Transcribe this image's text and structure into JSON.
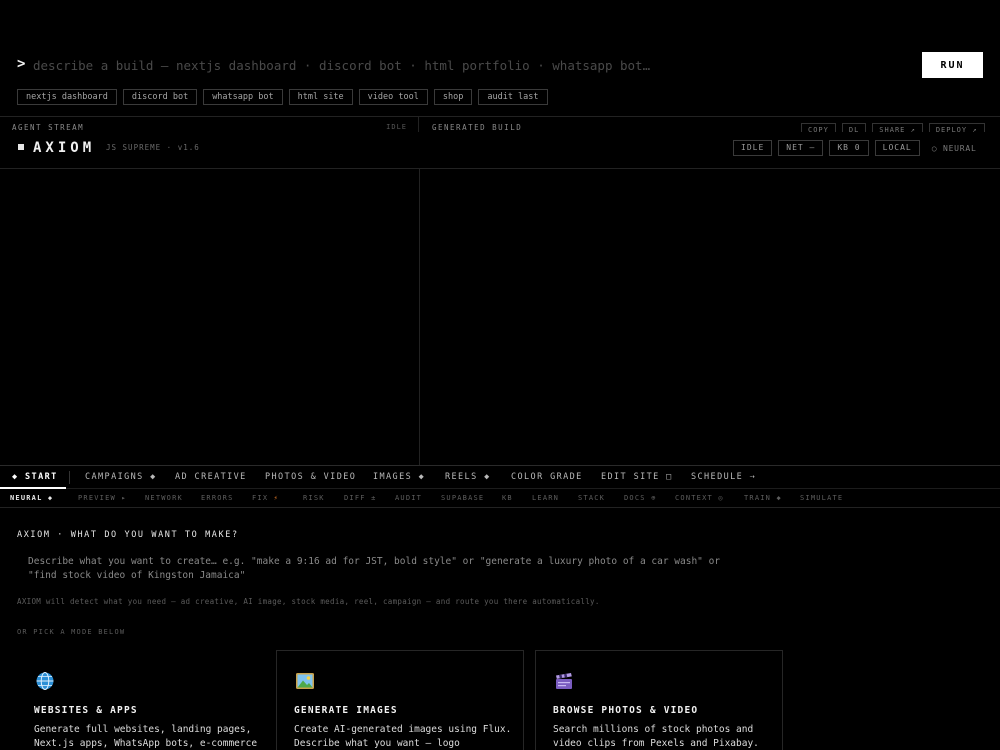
{
  "prompt": {
    "caret": ">",
    "placeholder": "describe a build — nextjs dashboard · discord bot · html portfolio · whatsapp bot…",
    "run_label": "RUN",
    "chips": [
      "nextjs dashboard",
      "discord bot",
      "whatsapp bot",
      "html site",
      "video tool",
      "shop",
      "audit last"
    ]
  },
  "panels": {
    "left_title": "AGENT STREAM",
    "left_status": "IDLE",
    "right_title": "GENERATED BUILD",
    "actions": [
      "COPY",
      "DL",
      "SHARE ↗",
      "DEPLOY ↗"
    ]
  },
  "brand": {
    "name": "AXIOM",
    "version": "JS SUPREME · v1.6",
    "status": [
      "IDLE",
      "NET —",
      "KB 0",
      "LOCAL"
    ],
    "neural": "○ NEURAL"
  },
  "main_tabs": [
    "◆ START",
    "CAMPAIGNS ◆",
    "AD CREATIVE",
    "PHOTOS & VIDEO",
    "IMAGES ◆",
    "REELS ◆",
    "COLOR GRADE",
    "EDIT SITE □",
    "SCHEDULE ⇢"
  ],
  "sub_tabs": [
    "NEURAL ◆",
    "PREVIEW ▸",
    "NETWORK",
    "ERRORS",
    "FIX",
    "RISK",
    "DIFF ±",
    "AUDIT",
    "SUPABASE",
    "KB",
    "LEARN",
    "STACK",
    "DOCS ⊕",
    "CONTEXT ◎",
    "TRAIN ◆",
    "SIMULATE"
  ],
  "start": {
    "title": "AXIOM · WHAT DO YOU WANT TO MAKE?",
    "describe": "Describe what you want to create… e.g. \"make a 9:16 ad for JST, bold style\" or \"generate a luxury photo of a car wash\" or \"find stock video of Kingston Jamaica\"",
    "auto_note": "AXIOM will detect what you need — ad creative, AI image, stock media, reel, campaign — and route you there automatically.",
    "pick_label": "OR PICK A MODE BELOW",
    "modes": [
      {
        "icon": "globe-icon",
        "title": "WEBSITES & APPS",
        "desc": "Generate full websites, landing pages, Next.js apps, WhatsApp bots, e-commerce"
      },
      {
        "icon": "picture-icon",
        "title": "GENERATE IMAGES",
        "desc": "Create AI-generated images using Flux. Describe what you want — logo"
      },
      {
        "icon": "clapper-icon",
        "title": "BROWSE PHOTOS & VIDEO",
        "desc": "Search millions of stock photos and video clips from Pexels and Pixabay."
      }
    ]
  },
  "colors": {
    "background": "#000000",
    "accent": "#ffffff",
    "fix_bolt": "#e07a2a",
    "border": "#222222"
  }
}
